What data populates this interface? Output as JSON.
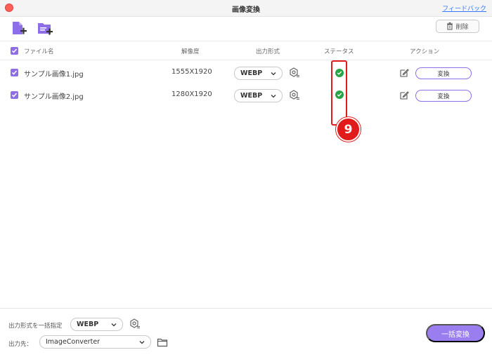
{
  "window": {
    "title": "画像変換",
    "feedback_link": "フィードバック"
  },
  "toolbar": {
    "add_file_icon": "file-add-icon",
    "add_folder_icon": "folder-add-icon",
    "delete_label": "削除"
  },
  "table": {
    "headers": {
      "filename": "ファイル名",
      "resolution": "解像度",
      "format": "出力形式",
      "status": "ステータス",
      "action": "アクション"
    },
    "rows": [
      {
        "filename": "サンプル画像1.jpg",
        "resolution": "1555X1920",
        "format": "WEBP",
        "status": "completed",
        "action_label": "変換"
      },
      {
        "filename": "サンプル画像2.jpg",
        "resolution": "1280X1920",
        "format": "WEBP",
        "status": "completed",
        "action_label": "変換"
      }
    ]
  },
  "annotation": {
    "step_number": "9",
    "color": "#e11b1b"
  },
  "footer": {
    "batch_format_label": "出力形式を一括指定",
    "batch_format_value": "WEBP",
    "output_label": "出力先：",
    "output_value": "ImageConverter",
    "batch_convert_label": "一括変換"
  },
  "colors": {
    "accent": "#8e6ee6",
    "status_ok": "#27a544",
    "link": "#3478f6"
  }
}
